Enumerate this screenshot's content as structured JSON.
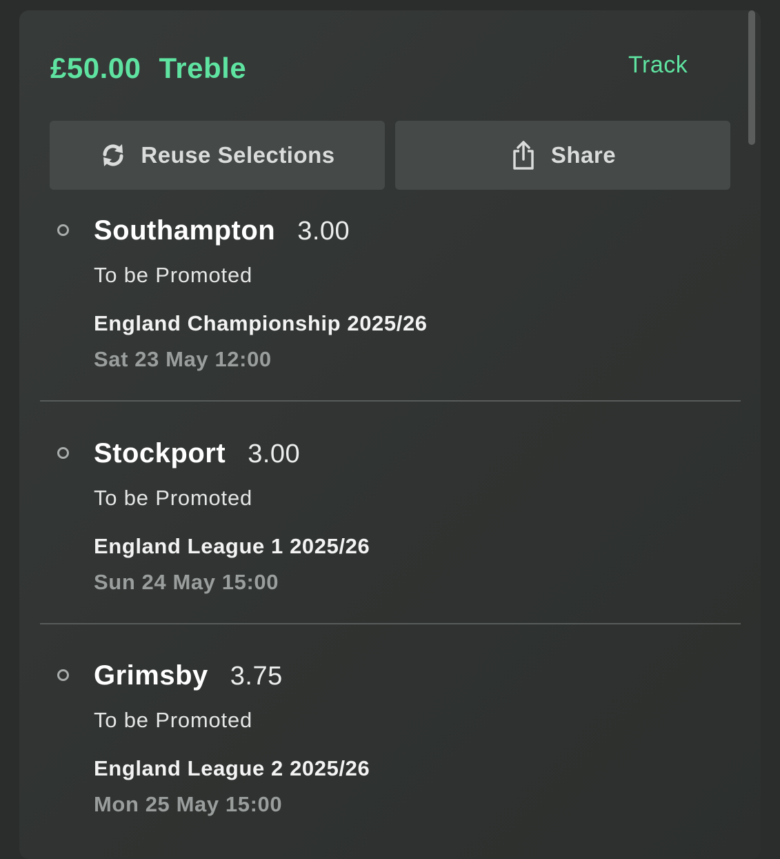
{
  "bet": {
    "stake": "£50.00",
    "type": "Treble",
    "track_label": "Track"
  },
  "actions": {
    "reuse_label": "Reuse Selections",
    "share_label": "Share"
  },
  "selections": [
    {
      "team": "Southampton",
      "odds": "3.00",
      "market": "To be Promoted",
      "competition": "England Championship 2025/26",
      "datetime": "Sat 23 May 12:00"
    },
    {
      "team": "Stockport",
      "odds": "3.00",
      "market": "To be Promoted",
      "competition": "England League 1 2025/26",
      "datetime": "Sun 24 May 15:00"
    },
    {
      "team": "Grimsby",
      "odds": "3.75",
      "market": "To be Promoted",
      "competition": "England League 2 2025/26",
      "datetime": "Mon 25 May 15:00"
    }
  ],
  "colors": {
    "accent": "#5fe3a1",
    "background": "#2b2d2c",
    "card": "#333634",
    "button": "#454948"
  }
}
